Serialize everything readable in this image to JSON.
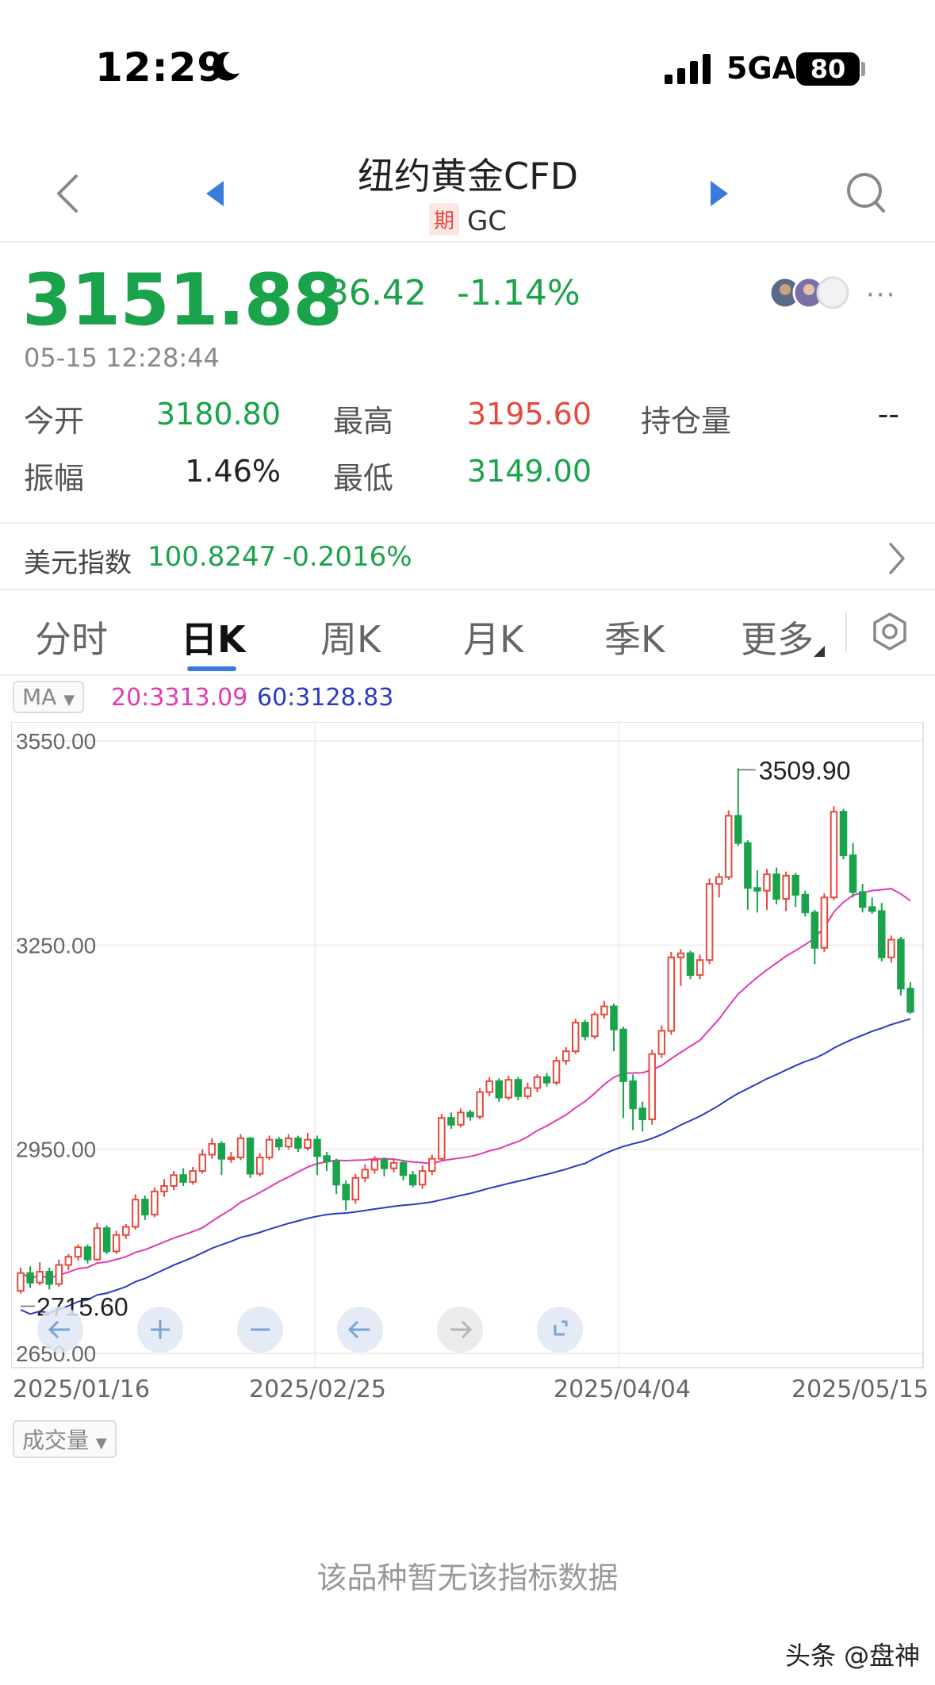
{
  "status_bar": {
    "time": "12:29",
    "network": "5GA",
    "battery": "80"
  },
  "header": {
    "title": "纽约黄金CFD",
    "badge": "期",
    "code": "GC"
  },
  "quote": {
    "price": "3151.88",
    "change": "-36.42",
    "change_pct": "-1.14%",
    "timestamp": "05-15 12:28:44",
    "more": "···"
  },
  "stats": [
    {
      "label": "今开",
      "value": "3180.80",
      "color": "#1aa34a"
    },
    {
      "label": "最高",
      "value": "3195.60",
      "color": "#e8483d"
    },
    {
      "label": "持仓量",
      "value": "--",
      "color": "#222222"
    },
    {
      "label": "振幅",
      "value": "1.46%",
      "color": "#222222"
    },
    {
      "label": "最低",
      "value": "3149.00",
      "color": "#1aa34a"
    }
  ],
  "usd_index": {
    "label": "美元指数",
    "value": "100.8247",
    "change": "-0.2016%"
  },
  "tabs": [
    {
      "label": "分时",
      "active": false
    },
    {
      "label": "日K",
      "active": true
    },
    {
      "label": "周K",
      "active": false
    },
    {
      "label": "月K",
      "active": false
    },
    {
      "label": "季K",
      "active": false
    },
    {
      "label": "更多",
      "active": false
    }
  ],
  "indicator": {
    "name": "MA",
    "ma20": "20:3313.09",
    "ma60": "60:3128.83"
  },
  "volume": {
    "name": "成交量",
    "empty_text": "该品种暂无该指标数据"
  },
  "watermark": "头条 @盘神",
  "chart_data": {
    "type": "candlestick",
    "y_ticks": [
      "3550.00",
      "3250.00",
      "2950.00",
      "2650.00"
    ],
    "ylim": [
      2650,
      3550
    ],
    "x_ticks": [
      "2025/01/16",
      "2025/02/25",
      "2025/04/04",
      "2025/05/15"
    ],
    "max_label": "3509.90",
    "min_label": "2715.60",
    "colors": {
      "up": "#e8483d",
      "down": "#1aa34a",
      "ma20": "#e13ab4",
      "ma60": "#2b3ac4"
    },
    "candles": [
      [
        2742,
        2768,
        2776,
        2738
      ],
      [
        2768,
        2754,
        2778,
        2746
      ],
      [
        2754,
        2770,
        2784,
        2750
      ],
      [
        2770,
        2752,
        2776,
        2744
      ],
      [
        2752,
        2780,
        2788,
        2748
      ],
      [
        2780,
        2792,
        2796,
        2772
      ],
      [
        2792,
        2806,
        2810,
        2786
      ],
      [
        2806,
        2788,
        2810,
        2782
      ],
      [
        2788,
        2834,
        2842,
        2786
      ],
      [
        2834,
        2800,
        2838,
        2796
      ],
      [
        2800,
        2824,
        2830,
        2796
      ],
      [
        2824,
        2836,
        2840,
        2818
      ],
      [
        2836,
        2876,
        2884,
        2832
      ],
      [
        2876,
        2854,
        2882,
        2846
      ],
      [
        2854,
        2888,
        2894,
        2850
      ],
      [
        2888,
        2896,
        2906,
        2880
      ],
      [
        2896,
        2912,
        2918,
        2890
      ],
      [
        2912,
        2902,
        2922,
        2896
      ],
      [
        2902,
        2918,
        2924,
        2898
      ],
      [
        2918,
        2942,
        2950,
        2914
      ],
      [
        2942,
        2958,
        2966,
        2936
      ],
      [
        2958,
        2936,
        2962,
        2912
      ],
      [
        2936,
        2938,
        2946,
        2930
      ],
      [
        2938,
        2966,
        2972,
        2934
      ],
      [
        2966,
        2914,
        2968,
        2908
      ],
      [
        2914,
        2938,
        2944,
        2910
      ],
      [
        2938,
        2964,
        2970,
        2934
      ],
      [
        2964,
        2954,
        2968,
        2948
      ],
      [
        2954,
        2966,
        2972,
        2950
      ],
      [
        2966,
        2952,
        2970,
        2946
      ],
      [
        2952,
        2964,
        2974,
        2948
      ],
      [
        2964,
        2940,
        2970,
        2912
      ],
      [
        2940,
        2932,
        2946,
        2918
      ],
      [
        2932,
        2898,
        2936,
        2884
      ],
      [
        2898,
        2876,
        2904,
        2860
      ],
      [
        2876,
        2908,
        2914,
        2870
      ],
      [
        2908,
        2920,
        2928,
        2902
      ],
      [
        2920,
        2934,
        2940,
        2914
      ],
      [
        2934,
        2922,
        2938,
        2910
      ],
      [
        2922,
        2930,
        2936,
        2916
      ],
      [
        2930,
        2912,
        2934,
        2904
      ],
      [
        2912,
        2898,
        2918,
        2894
      ],
      [
        2898,
        2918,
        2926,
        2892
      ],
      [
        2918,
        2936,
        2942,
        2912
      ],
      [
        2936,
        2996,
        3002,
        2932
      ],
      [
        2996,
        2986,
        3004,
        2980
      ],
      [
        2986,
        3004,
        3010,
        2982
      ],
      [
        3004,
        2998,
        3008,
        2992
      ],
      [
        2998,
        3034,
        3040,
        2994
      ],
      [
        3034,
        3050,
        3056,
        3028
      ],
      [
        3050,
        3026,
        3054,
        3020
      ],
      [
        3026,
        3052,
        3058,
        3022
      ],
      [
        3052,
        3028,
        3056,
        3022
      ],
      [
        3028,
        3040,
        3048,
        3024
      ],
      [
        3040,
        3056,
        3060,
        3034
      ],
      [
        3056,
        3048,
        3062,
        3042
      ],
      [
        3048,
        3080,
        3086,
        3044
      ],
      [
        3080,
        3094,
        3100,
        3074
      ],
      [
        3094,
        3136,
        3142,
        3090
      ],
      [
        3136,
        3116,
        3140,
        3110
      ],
      [
        3116,
        3148,
        3152,
        3112
      ],
      [
        3148,
        3160,
        3168,
        3142
      ],
      [
        3160,
        3126,
        3164,
        3094
      ],
      [
        3126,
        3050,
        3130,
        2996
      ],
      [
        3050,
        3010,
        3060,
        2978
      ],
      [
        3010,
        2994,
        3020,
        2976
      ],
      [
        2994,
        3090,
        3096,
        2986
      ],
      [
        3090,
        3124,
        3132,
        3084
      ],
      [
        3124,
        3232,
        3240,
        3118
      ],
      [
        3232,
        3238,
        3244,
        3190
      ],
      [
        3238,
        3206,
        3242,
        3200
      ],
      [
        3206,
        3228,
        3236,
        3200
      ],
      [
        3228,
        3340,
        3348,
        3222
      ],
      [
        3340,
        3350,
        3356,
        3320
      ],
      [
        3350,
        3440,
        3448,
        3346
      ],
      [
        3440,
        3400,
        3509.9,
        3396
      ],
      [
        3400,
        3334,
        3404,
        3302
      ],
      [
        3334,
        3330,
        3360,
        3298
      ],
      [
        3330,
        3354,
        3362,
        3302
      ],
      [
        3354,
        3318,
        3364,
        3310
      ],
      [
        3318,
        3352,
        3358,
        3300
      ],
      [
        3352,
        3324,
        3356,
        3306
      ],
      [
        3324,
        3298,
        3330,
        3292
      ],
      [
        3298,
        3246,
        3302,
        3222
      ],
      [
        3246,
        3320,
        3326,
        3240
      ],
      [
        3320,
        3446,
        3454,
        3316
      ],
      [
        3446,
        3382,
        3450,
        3376
      ],
      [
        3382,
        3328,
        3400,
        3320
      ],
      [
        3328,
        3306,
        3340,
        3298
      ],
      [
        3306,
        3300,
        3320,
        3296
      ],
      [
        3300,
        3232,
        3312,
        3226
      ],
      [
        3232,
        3258,
        3264,
        3224
      ],
      [
        3258,
        3186,
        3262,
        3176
      ],
      [
        3186,
        3151.88,
        3195.6,
        3149
      ]
    ]
  }
}
